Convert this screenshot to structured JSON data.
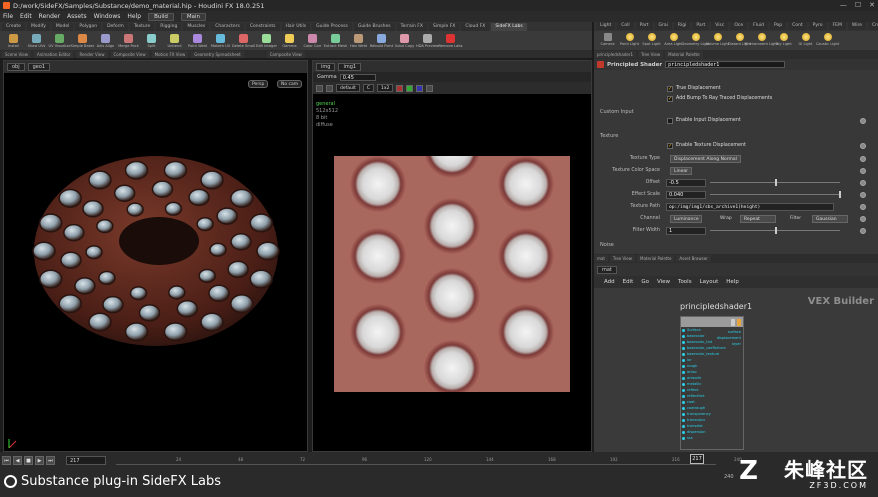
{
  "window": {
    "title": "D:/work/SideFX/Samples/Substance/demo_material.hip - Houdini FX 18.0.251",
    "controls": [
      "—",
      "☐",
      "✕"
    ]
  },
  "menubar": {
    "items": [
      "File",
      "Edit",
      "Render",
      "Assets",
      "Windows",
      "Help"
    ],
    "desktop": "Build",
    "context": "Main"
  },
  "shelf": {
    "tabs": [
      "Create",
      "Modify",
      "Model",
      "Polygon",
      "Deform",
      "Texture",
      "Rigging",
      "Muscles",
      "Characters",
      "Constraints",
      "Hair Utils",
      "Guide Process",
      "Guide Brushes",
      "Terrain FX",
      "Simple FX",
      "Cloud FX",
      "SideFX Labs"
    ],
    "active_tab": "SideFX Labs",
    "tools": [
      "Install",
      "Show UVs",
      "UV Visualize",
      "Simple Baker",
      "Axis Align",
      "Merge Pack",
      "Split",
      "Unbend",
      "Point Weld",
      "Maketh UV",
      "Delete Small",
      "Edit Integer",
      "Gamma",
      "Color Corr",
      "Extract Mesh",
      "Hex Weld",
      "Rebuild Point",
      "Subd Copy",
      "HDA Preview",
      "Remove Labs"
    ]
  },
  "lightshelf": {
    "tabs": [
      "Light",
      "Coll",
      "Part",
      "Grai",
      "Rigi",
      "Part",
      "Visc",
      "Oce",
      "Fluid",
      "Pop",
      "Cont",
      "Pyro",
      "FEM",
      "Wire",
      "Crowd",
      "Drive"
    ],
    "tools": [
      "Camera",
      "Point Light",
      "Spot Light",
      "Area Light",
      "Geometry Light",
      "Volume Light",
      "Distant Light",
      "Environment Light",
      "Sky Light",
      "GI Light",
      "Caustic Light"
    ]
  },
  "pane_tabs_left": [
    "Scene View",
    "Animation Editor",
    "Render View",
    "Composite View",
    "Motion FX View",
    "Geometry Spreadsheet"
  ],
  "pane_tabs_mid": [
    "Composite View"
  ],
  "viewport": {
    "path": "obj",
    "object": "geo1",
    "persp_label": "Persp",
    "cam_label": "No cam"
  },
  "compview": {
    "path": "img",
    "node": "img1",
    "gamma_label": "Gamma",
    "gamma_value": "0.45",
    "view_mode": "default",
    "lut": "C",
    "resolution": "1x2",
    "info_lines": [
      "general",
      "512x512",
      "8 bit",
      "diffuse"
    ]
  },
  "params": {
    "tabs": [
      "principledshader1",
      "Tree View",
      "Material Palette"
    ],
    "node_type": "Principled Shader",
    "node_name": "principledshader1",
    "rows": {
      "true_displacement": "True Displacement",
      "add_bump": "Add Bump To Ray Traced Displacements",
      "custom_input_header": "Custom Input",
      "enable_input_disp": "Enable Input Displacement",
      "texture_header": "Texture",
      "enable_tex_disp": "Enable Texture Displacement",
      "texture_type_label": "Texture Type",
      "texture_type_value": "Displacement Along Normal",
      "color_space_label": "Texture Color Space",
      "color_space_value": "Linear",
      "offset_label": "Offset",
      "offset_value": "-0.5",
      "effect_scale_label": "Effect Scale",
      "effect_scale_value": "0.040",
      "texture_path_label": "Texture Path",
      "texture_path_value": "op:/img/img1/sbs_archive1(height)",
      "channel_label": "Channel",
      "channel_value": "Luminance",
      "wrap_label": "Wrap",
      "wrap_value": "Repeat",
      "filter_label": "Filter",
      "filter_value": "Gaussian",
      "filter_width_label": "Filter Width",
      "filter_width_value": "1",
      "noise_header": "Noise"
    },
    "offset_fraction": 0.5,
    "scale_fraction": 0.04
  },
  "network": {
    "tabs": [
      "mat",
      "Tree View",
      "Material Palette",
      "Asset Browser"
    ],
    "path": "mat",
    "menu": [
      "Add",
      "Edit",
      "Go",
      "View",
      "Tools",
      "Layout",
      "Help"
    ],
    "builder_label": "VEX Builder",
    "node_name": "principledshader1",
    "inputs": [
      "Surface",
      "basecolor",
      "basecolor_tint",
      "basecolor_useTexture",
      "basecolor_texture",
      "ior",
      "rough",
      "aniso",
      "anisodir",
      "metallic",
      "reflect",
      "reflecttint",
      "coat",
      "coatrough",
      "transparency",
      "transcolor",
      "transdist",
      "dispersion",
      "sss"
    ],
    "outputs": [
      "surface",
      "displacement",
      "layer"
    ]
  },
  "timeline": {
    "buttons": [
      "⏮",
      "◀",
      "■",
      "▶",
      "⏭"
    ],
    "frame": "217",
    "ticks": [
      "24",
      "48",
      "72",
      "96",
      "120",
      "144",
      "168",
      "192",
      "216",
      "240"
    ],
    "current_frame": "217",
    "end_frame": "240",
    "caption": "Substance plug-in SideFX Labs"
  },
  "watermark": {
    "logo": "Z",
    "cn": "朱峰社区",
    "url": "ZF3D.COM"
  }
}
